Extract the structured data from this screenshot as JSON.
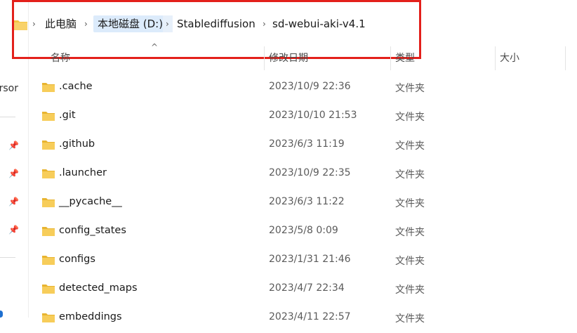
{
  "breadcrumb": {
    "items": [
      "此电脑",
      "本地磁盘 (D:)",
      "Stablediffusion",
      "sd-webui-aki-v4.1"
    ]
  },
  "columns": {
    "name": "名称",
    "date": "修改日期",
    "type": "类型",
    "size": "大小"
  },
  "sidebar": {
    "truncated_label": "ersor"
  },
  "files": [
    {
      "name": ".cache",
      "date": "2023/10/9 22:36",
      "type": "文件夹"
    },
    {
      "name": ".git",
      "date": "2023/10/10 21:53",
      "type": "文件夹"
    },
    {
      "name": ".github",
      "date": "2023/6/3 11:19",
      "type": "文件夹"
    },
    {
      "name": ".launcher",
      "date": "2023/10/9 22:35",
      "type": "文件夹"
    },
    {
      "name": "__pycache__",
      "date": "2023/6/3 11:22",
      "type": "文件夹"
    },
    {
      "name": "config_states",
      "date": "2023/5/8 0:09",
      "type": "文件夹"
    },
    {
      "name": "configs",
      "date": "2023/1/31 21:46",
      "type": "文件夹"
    },
    {
      "name": "detected_maps",
      "date": "2023/4/7 22:34",
      "type": "文件夹"
    },
    {
      "name": "embeddings",
      "date": "2023/4/11 22:57",
      "type": "文件夹"
    }
  ],
  "colors": {
    "highlight": "#e3201b",
    "folder": "#f4c542",
    "selected_crumb": "#dcebfb"
  },
  "icons": [
    "folder-icon",
    "chevron-right-icon",
    "pin-icon",
    "sort-up-icon"
  ]
}
